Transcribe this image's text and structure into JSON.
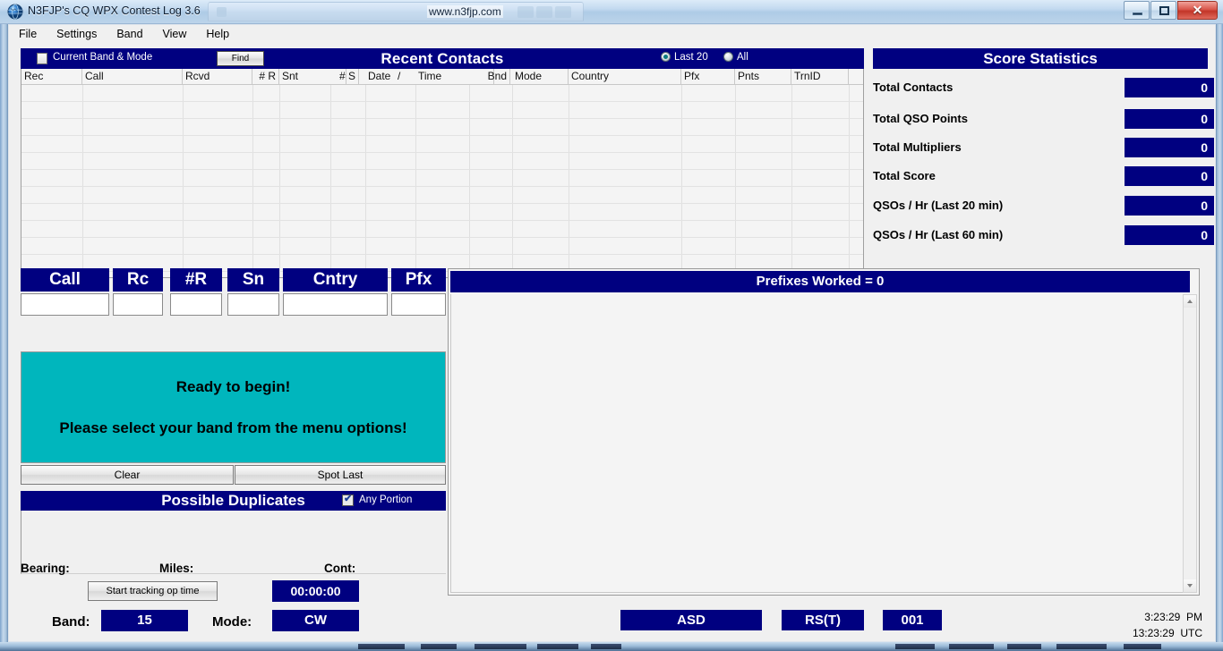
{
  "window": {
    "title": "N3FJP's CQ WPX Contest Log 3.6",
    "url_text": "www.n3fjp.com",
    "icon": "globe-icon",
    "minimize_label": "–",
    "maximize_label": "□",
    "close_label": "✕"
  },
  "menu": {
    "items": [
      "File",
      "Settings",
      "Band",
      "View",
      "Help"
    ]
  },
  "recent_contacts": {
    "title": "Recent Contacts",
    "current_band_mode_label": "Current Band & Mode",
    "current_band_mode_checked": false,
    "find_label": "Find",
    "filters": [
      {
        "label": "Last 20",
        "selected": true
      },
      {
        "label": "All",
        "selected": false
      }
    ],
    "columns": [
      "Rec",
      "Call",
      "Rcvd",
      "# R",
      "Snt",
      "# S",
      "Date",
      "/",
      "Time",
      "Bnd",
      "Mode",
      "Country",
      "Pfx",
      "Pnts",
      "TrnID"
    ],
    "rows": []
  },
  "score_statistics": {
    "title": "Score Statistics",
    "rows": [
      {
        "label": "Total Contacts",
        "value": "0"
      },
      {
        "label": "Total QSO Points",
        "value": "0"
      },
      {
        "label": "Total Multipliers",
        "value": "0"
      },
      {
        "label": "Total Score",
        "value": "0"
      },
      {
        "label": "QSOs / Hr (Last 20 min)",
        "value": "0"
      },
      {
        "label": "QSOs / Hr (Last 60 min)",
        "value": "0"
      }
    ]
  },
  "entry_fields": [
    {
      "label": "Call",
      "value": ""
    },
    {
      "label": "Rc",
      "value": ""
    },
    {
      "label": "#R",
      "value": ""
    },
    {
      "label": "Sn",
      "value": ""
    },
    {
      "label": "Cntry",
      "value": ""
    },
    {
      "label": "Pfx",
      "value": ""
    }
  ],
  "status_panel": {
    "line1": "Ready to begin!",
    "line2": "Please select your band from the menu options!",
    "background_color": "#00b6bd"
  },
  "action_buttons": {
    "clear": "Clear",
    "spot_last": "Spot Last"
  },
  "possible_duplicates": {
    "title": "Possible Duplicates",
    "any_portion_label": "Any Portion",
    "any_portion_checked": true,
    "entries": []
  },
  "info_bar": {
    "bearing_label": "Bearing:",
    "bearing_value": "",
    "miles_label": "Miles:",
    "miles_value": "",
    "cont_label": "Cont:",
    "cont_value": "",
    "op_time_button": "Start tracking op time",
    "op_time_value": "00:00:00",
    "band_label": "Band:",
    "band_value": "15",
    "mode_label": "Mode:",
    "mode_value": "CW"
  },
  "prefixes": {
    "title": "Prefixes Worked = 0",
    "entries": []
  },
  "bottom_fields": {
    "exchange": "ASD",
    "rst": "RS(T)",
    "serial": "001"
  },
  "clock": {
    "local_time": "3:23:29",
    "local_suffix": "PM",
    "utc_time": "13:23:29",
    "utc_suffix": "UTC"
  },
  "colors": {
    "navy": "#000080",
    "teal": "#00b6bd",
    "window_bg": "#f0f0f0"
  }
}
